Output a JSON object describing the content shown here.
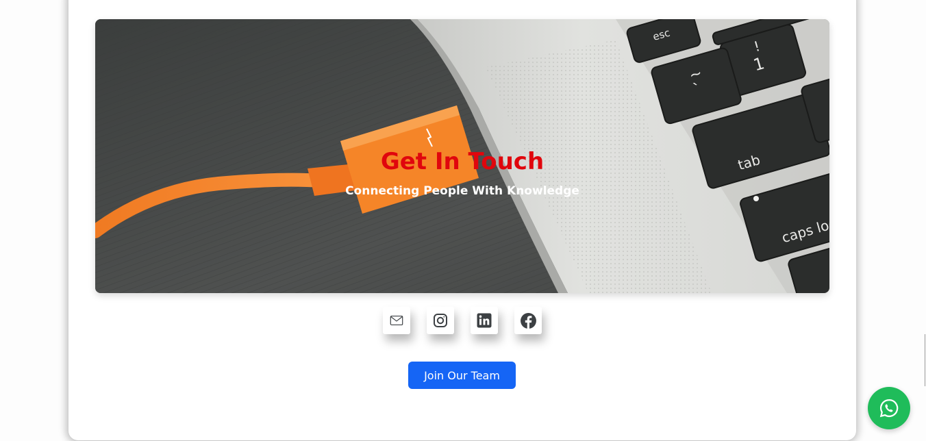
{
  "hero": {
    "title": "Get In Touch",
    "subtitle": "Connecting People With Knowledge",
    "image_description_alt": "",
    "keyboard_keys": [
      "esc",
      "!",
      "1",
      "tab",
      "caps lock"
    ]
  },
  "social": [
    {
      "name": "email",
      "icon": "mail-icon"
    },
    {
      "name": "instagram",
      "icon": "instagram-icon"
    },
    {
      "name": "linkedin",
      "icon": "linkedin-icon"
    },
    {
      "name": "facebook",
      "icon": "facebook-icon"
    }
  ],
  "cta": {
    "join_label": "Join Our Team"
  },
  "floating": {
    "icon": "whatsapp-icon"
  },
  "colors": {
    "title_red": "#e0060d",
    "button_blue": "#1565f5",
    "whatsapp_green": "#1fbc5a",
    "cable_orange": "#f47c2a"
  }
}
